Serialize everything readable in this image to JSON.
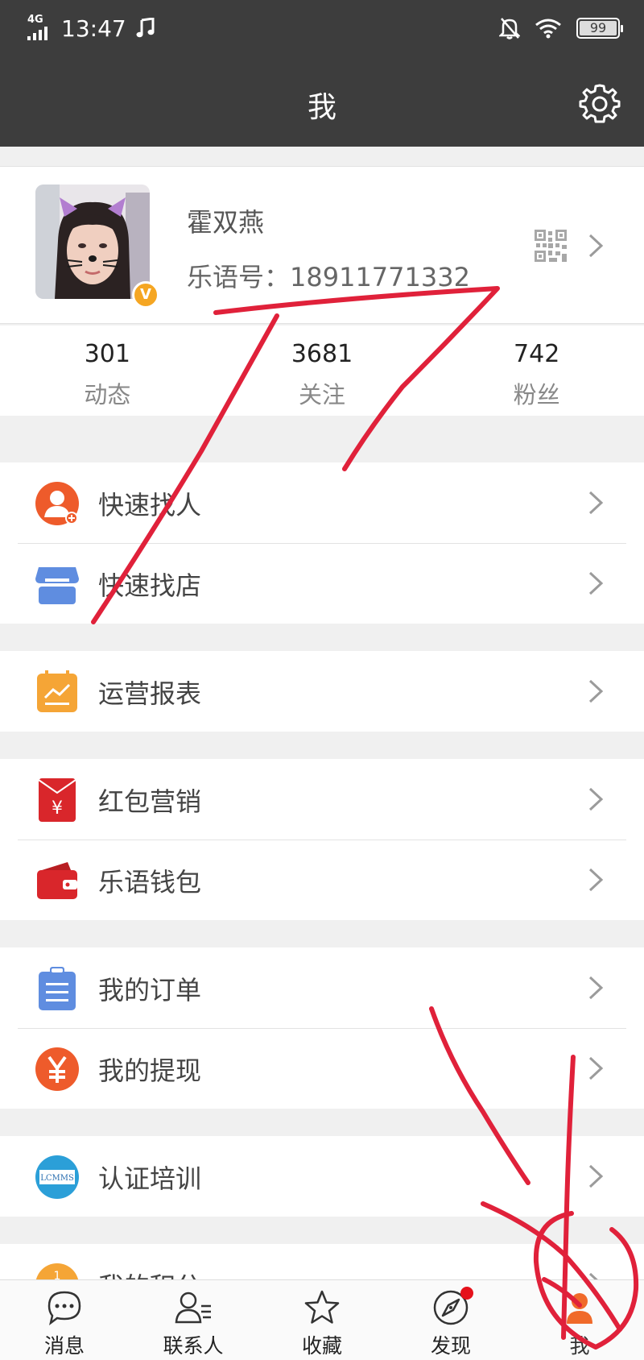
{
  "status": {
    "time": "13:47",
    "network": "4G",
    "battery": "99"
  },
  "header": {
    "title": "我"
  },
  "profile": {
    "name": "霍双燕",
    "id_label": "乐语号：18911771332",
    "badge": "V"
  },
  "stats": [
    {
      "value": "301",
      "label": "动态"
    },
    {
      "value": "3681",
      "label": "关注"
    },
    {
      "value": "742",
      "label": "粉丝"
    }
  ],
  "menu": {
    "find_person": "快速找人",
    "find_shop": "快速找店",
    "reports": "运营报表",
    "red_packet": "红包营销",
    "wallet": "乐语钱包",
    "orders": "我的订单",
    "withdraw": "我的提现",
    "training": "认证培训",
    "points": "我的积分"
  },
  "icons": {
    "find_person": "person-add-icon",
    "find_shop": "shop-icon",
    "reports": "report-chart-icon",
    "red_packet": "red-packet-icon",
    "wallet": "wallet-icon",
    "orders": "clipboard-icon",
    "withdraw": "yen-coin-icon",
    "training": "lcmms-logo-icon"
  },
  "training_logo_text": "LCMMS",
  "tabs": [
    {
      "label": "消息",
      "icon": "chat-icon"
    },
    {
      "label": "联系人",
      "icon": "contacts-icon"
    },
    {
      "label": "收藏",
      "icon": "star-icon"
    },
    {
      "label": "发现",
      "icon": "compass-icon"
    },
    {
      "label": "我",
      "icon": "me-icon"
    }
  ],
  "colors": {
    "header": "#3d3d3d",
    "accent": "#f06a2a",
    "annotation": "#e0213a",
    "badge": "#f5a623"
  }
}
